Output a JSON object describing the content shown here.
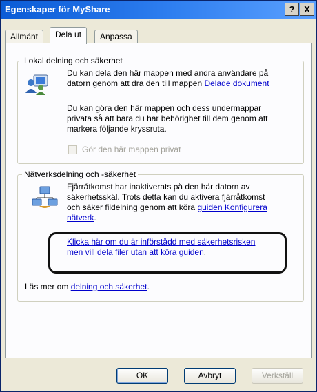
{
  "window": {
    "title": "Egenskaper för MyShare",
    "help_button": "?",
    "close_button": "X"
  },
  "tabs": [
    {
      "label": "Allmänt",
      "active": false
    },
    {
      "label": "Dela ut",
      "active": true
    },
    {
      "label": "Anpassa",
      "active": false
    }
  ],
  "local_sharing": {
    "legend": "Lokal delning och säkerhet",
    "line1": "Du kan dela den här mappen med andra användare på",
    "line2_prefix": "datorn genom att dra den till mappen ",
    "shared_docs_link": "Delade dokument",
    "para2_line1": "Du kan göra den här mappen och dess undermappar",
    "para2_line2": "privata så att bara du har behörighet till dem genom att",
    "para2_line3": "markera följande kryssruta.",
    "private_checkbox_label": "Gör den här mappen privat",
    "private_checked": false
  },
  "network_sharing": {
    "legend": "Nätverksdelning och -säkerhet",
    "line1": "Fjärråtkomst har inaktiverats på den här datorn av",
    "line2": "säkerhetsskäl. Trots detta kan du aktivera fjärråtkomst",
    "line3_prefix": "och säker fildelning genom att köra ",
    "wizard_link_part1": "guiden Konfigurera",
    "wizard_link_part2": "nätverk",
    "line4_suffix": ".",
    "risk_link_line1": "Klicka här om du är införstådd med säkerhetsrisken",
    "risk_link_line2": "men vill dela filer utan att köra guiden",
    "risk_link_suffix": ".",
    "learn_more_prefix": "Läs mer om ",
    "learn_more_link": "delning och säkerhet",
    "learn_more_suffix": "."
  },
  "buttons": {
    "ok": "OK",
    "cancel": "Avbryt",
    "apply": "Verkställ"
  },
  "icons": {
    "local": "computer-users-icon",
    "network": "network-share-icon"
  }
}
